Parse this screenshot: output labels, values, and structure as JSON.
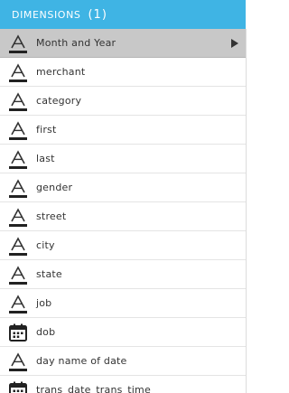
{
  "header": {
    "title": "DIMENSIONS",
    "count": "(1)"
  },
  "dimensions": [
    {
      "label": "Month and Year",
      "icon": "text-type-icon",
      "selected": true
    },
    {
      "label": "merchant",
      "icon": "text-type-icon"
    },
    {
      "label": "category",
      "icon": "text-type-icon"
    },
    {
      "label": "first",
      "icon": "text-type-icon"
    },
    {
      "label": "last",
      "icon": "text-type-icon"
    },
    {
      "label": "gender",
      "icon": "text-type-icon"
    },
    {
      "label": "street",
      "icon": "text-type-icon"
    },
    {
      "label": "city",
      "icon": "text-type-icon"
    },
    {
      "label": "state",
      "icon": "text-type-icon"
    },
    {
      "label": "job",
      "icon": "text-type-icon"
    },
    {
      "label": "dob",
      "icon": "calendar-type-icon"
    },
    {
      "label": "day name of date",
      "icon": "text-type-icon"
    },
    {
      "label": "trans_date_trans_time",
      "icon": "calendar-type-icon"
    }
  ],
  "colors": {
    "header_bg": "#3fb4e4",
    "selected_bg": "#c8c8c8"
  }
}
